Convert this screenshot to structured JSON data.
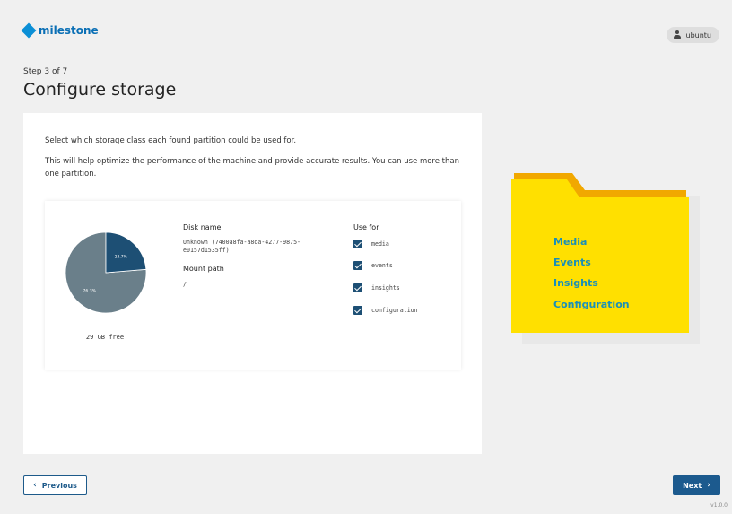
{
  "header": {
    "brand": "milestone",
    "user": "ubuntu"
  },
  "step": "Step 3 of 7",
  "title": "Configure storage",
  "intro": "Select which storage class each found partition could be used for.",
  "help": "This will help optimize the performance of the machine and provide accurate results. You can use more than one partition.",
  "disk": {
    "used_pct": 23.7,
    "free_pct": 76.3,
    "used_label": "23.7%",
    "free_label": "76.3%",
    "free_text": "29 GB free",
    "used_color": "#1d4f74",
    "free_color": "#6a7f8a",
    "name_label": "Disk name",
    "name_value": "Unknown (7400a8fa-a8da-4277-9875-e0157d1535ff)",
    "mount_label": "Mount path",
    "mount_value": "/",
    "use_label": "Use for",
    "uses": [
      {
        "label": "media",
        "checked": true
      },
      {
        "label": "events",
        "checked": true
      },
      {
        "label": "insights",
        "checked": true
      },
      {
        "label": "configuration",
        "checked": true
      }
    ]
  },
  "folder": {
    "items": [
      "Media",
      "Events",
      "Insights",
      "Configuration"
    ],
    "color": "#ffe000"
  },
  "nav": {
    "previous": "Previous",
    "next": "Next",
    "version": "v1.0.0"
  }
}
